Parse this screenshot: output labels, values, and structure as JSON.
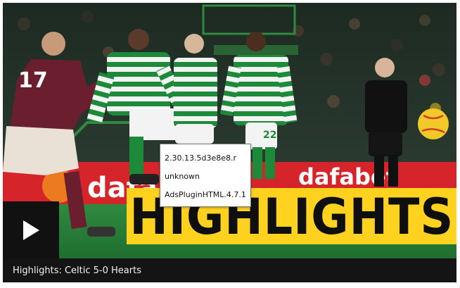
{
  "video": {
    "title": "Highlights: Celtic 5-0 Hearts",
    "banner_text": "HIGHLIGHTS",
    "play_icon": "play-icon"
  },
  "scene": {
    "player_numbers": {
      "left_player": "17",
      "right_player": "22"
    },
    "board_text": "dafabet",
    "shirt_sponsor": "dafabet"
  },
  "debug_tooltip": {
    "lines": [
      "2.30.13.5d3e8e8.r",
      "unknown",
      "AdsPluginHTML.4.7.1"
    ]
  },
  "colors": {
    "banner": "#ffd21f",
    "caption_bar": "#141414",
    "celtic_green": "#1d8a3a",
    "hearts_maroon": "#6b1f2e",
    "ad_board_red": "#d6242b"
  }
}
